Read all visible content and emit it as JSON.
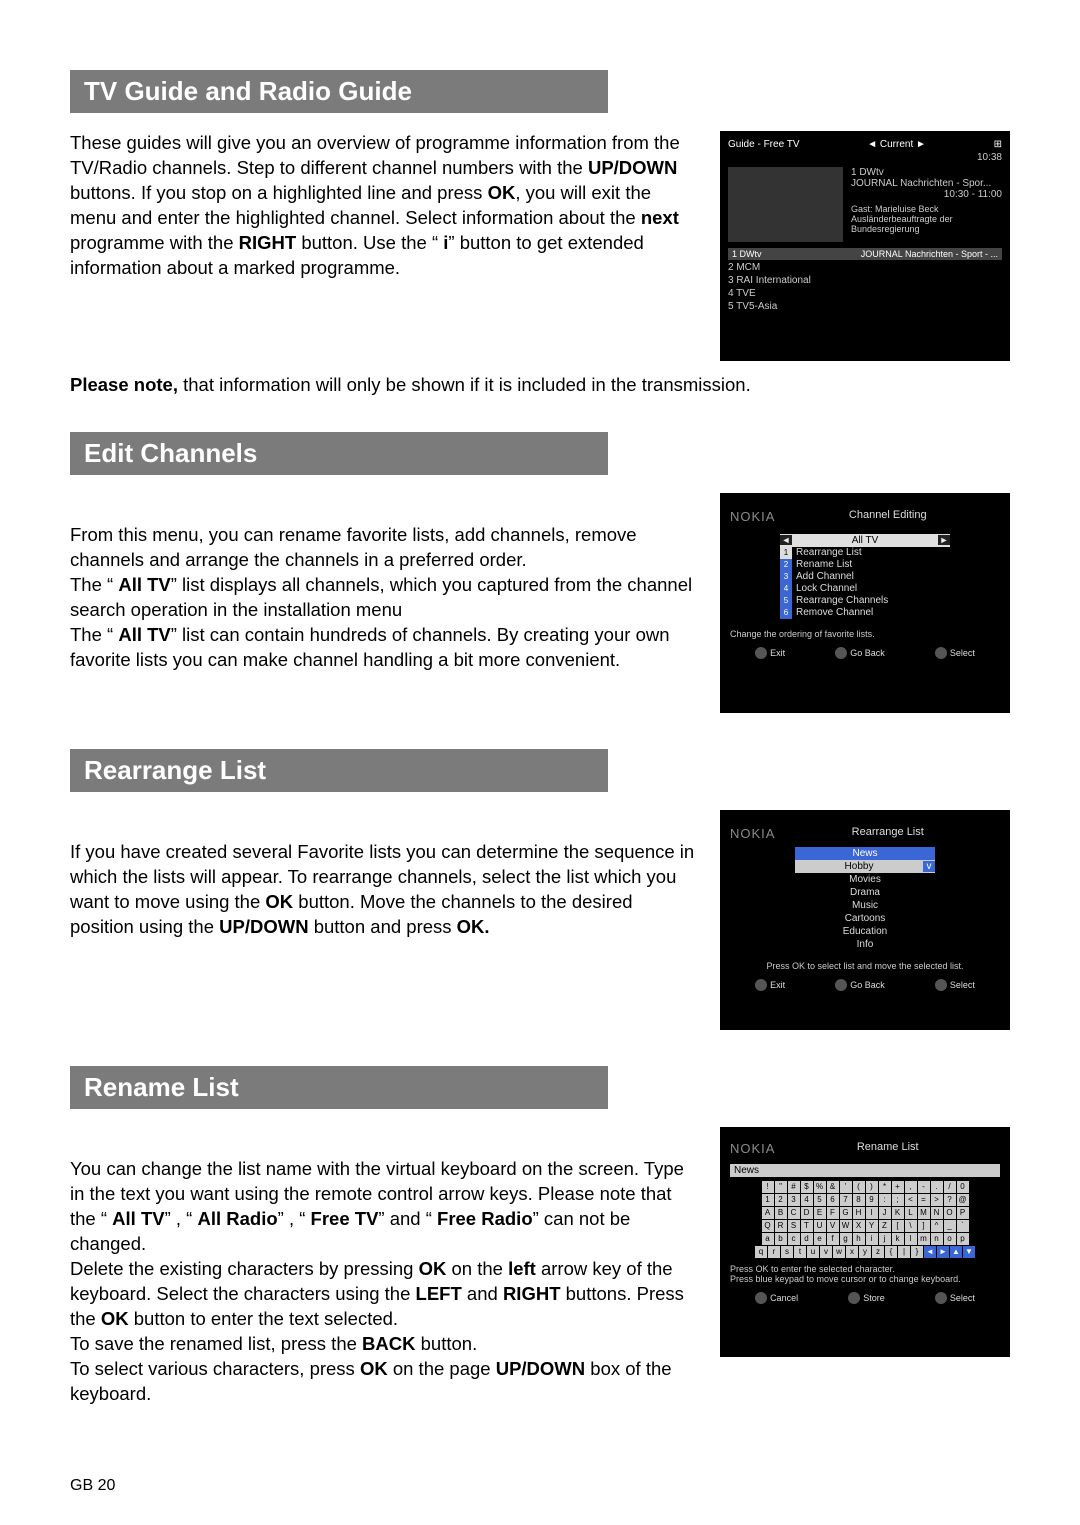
{
  "page_number": "GB 20",
  "sections": {
    "tv_guide": {
      "heading": "TV Guide and Radio Guide",
      "p1_a": "These guides will give you an overview of programme information from the TV/Radio channels. Step to different channel numbers with the ",
      "p1_updown": "UP/DOWN",
      "p1_b": " buttons. If you stop on a highlighted line and press ",
      "p1_ok": "OK",
      "p1_c": ", you will exit the menu and enter the highlighted channel. Select information about the ",
      "p1_next": "next",
      "p1_d": " programme with the ",
      "p1_right": "RIGHT",
      "p1_e": " button. Use the “ ",
      "p1_i": "i",
      "p1_f": "” button to get extended information about a marked programme.",
      "p2_a": "Please note,",
      "p2_b": " that information will only be shown if it is included in the transmission."
    },
    "edit_channels": {
      "heading": "Edit Channels",
      "p1": "From this menu, you can rename favorite lists, add channels, remove channels and arrange the channels in a preferred order.",
      "p2_a": "The “ ",
      "p2_alltv": "All TV",
      "p2_b": "”  list displays all channels, which you captured from the channel search operation in the installation menu",
      "p3_a": "The “ ",
      "p3_alltv": "All TV",
      "p3_b": "”  list can contain hundreds of channels. By creating your own favorite lists you can make channel handling a bit more convenient."
    },
    "rearrange_list": {
      "heading": "Rearrange List",
      "p1_a": "If you have created several Favorite lists you can determine the sequence in which the lists will appear. To rearrange channels, select the list which you want to move using the ",
      "p1_ok": "OK",
      "p1_b": " button. Move the channels to the desired position using the ",
      "p1_updown": "UP/DOWN",
      "p1_c": " button and press ",
      "p1_ok2": "OK.",
      "p1_end": ""
    },
    "rename_list": {
      "heading": "Rename List",
      "p1_a": "You can change the list name with the virtual keyboard on the screen. Type in the text you want using the remote control arrow keys. Please note that the “ ",
      "p1_alltv": "All TV",
      "p1_b": "” , “ ",
      "p1_allradio": "All Radio",
      "p1_c": "” , “ ",
      "p1_freetv": "Free TV",
      "p1_d": "”  and “ ",
      "p1_freeradio": "Free Radio",
      "p1_e": "”  can not be changed.",
      "p2_a": "Delete the existing characters by pressing ",
      "p2_ok": "OK",
      "p2_b": " on the ",
      "p2_left": "left",
      "p2_c": " arrow key of the keyboard. Select the characters using the ",
      "p2_LEFT": "LEFT",
      "p2_d": " and ",
      "p2_RIGHT": "RIGHT",
      "p2_e": " buttons. Press the ",
      "p2_ok2": "OK",
      "p2_f": " button to enter the text selected.",
      "p3_a": "To save the renamed list, press the ",
      "p3_back": "BACK",
      "p3_b": " button.",
      "p4_a": "To select various characters, press ",
      "p4_ok": "OK",
      "p4_b": " on the page ",
      "p4_updown": "UP/DOWN",
      "p4_c": " box of the keyboard."
    }
  },
  "screenshots": {
    "guide": {
      "title": "Guide - Free TV",
      "nav": "◄  Current  ►",
      "time": "10:38",
      "current_ch": "1  DWtv",
      "prog1": "JOURNAL Nachrichten - Spor...",
      "prog_time": "10:30 - 11:00",
      "guest": "Gast: Marieluise Beck Ausländerbeauftragte der Bundesregierung",
      "bar_left": "1 DWtv",
      "bar_right": "JOURNAL Nachrichten - Sport - ...",
      "channels": [
        "2 MCM",
        "3 RAI International",
        "4 TVE",
        "5 TV5-Asia"
      ]
    },
    "edit": {
      "brand": "NOKIA",
      "title": "Channel Editing",
      "top": "All TV",
      "items": [
        "Rearrange List",
        "Rename List",
        "Add Channel",
        "Lock Channel",
        "Rearrange Channels",
        "Remove Channel"
      ],
      "hint": "Change the ordering of favorite lists.",
      "btns": [
        "Exit",
        "Go Back",
        "Select"
      ]
    },
    "rearrange": {
      "brand": "NOKIA",
      "title": "Rearrange List",
      "hdr": "News",
      "sel": "Hobby",
      "items": [
        "Movies",
        "Drama",
        "Music",
        "Cartoons",
        "Education",
        "Info"
      ],
      "hint": "Press OK to select list and move the selected list.",
      "btns": [
        "Exit",
        "Go Back",
        "Select"
      ]
    },
    "rename": {
      "brand": "NOKIA",
      "title": "Rename List",
      "field": "News",
      "rows": [
        [
          "!",
          "\"",
          "#",
          "$",
          "%",
          "&",
          "'",
          "(",
          ")",
          "*",
          "+",
          ",",
          "-",
          ".",
          "/",
          "0"
        ],
        [
          "1",
          "2",
          "3",
          "4",
          "5",
          "6",
          "7",
          "8",
          "9",
          ":",
          ";",
          "<",
          "=",
          ">",
          "?",
          "@"
        ],
        [
          "A",
          "B",
          "C",
          "D",
          "E",
          "F",
          "G",
          "H",
          "I",
          "J",
          "K",
          "L",
          "M",
          "N",
          "O",
          "P"
        ],
        [
          "Q",
          "R",
          "S",
          "T",
          "U",
          "V",
          "W",
          "X",
          "Y",
          "Z",
          "[",
          "\\",
          "]",
          "^",
          "_",
          "`"
        ],
        [
          "a",
          "b",
          "c",
          "d",
          "e",
          "f",
          "g",
          "h",
          "i",
          "j",
          "k",
          "l",
          "m",
          "n",
          "o",
          "p"
        ],
        [
          "q",
          "r",
          "s",
          "t",
          "u",
          "v",
          "w",
          "x",
          "y",
          "z",
          "{",
          "|",
          "}",
          "◄",
          "►",
          "▲",
          "▼"
        ]
      ],
      "hint1": "Press OK to enter the selected character.",
      "hint2": "Press blue keypad to move cursor or to change keyboard.",
      "btns": [
        "Cancel",
        "Store",
        "Select"
      ]
    }
  }
}
